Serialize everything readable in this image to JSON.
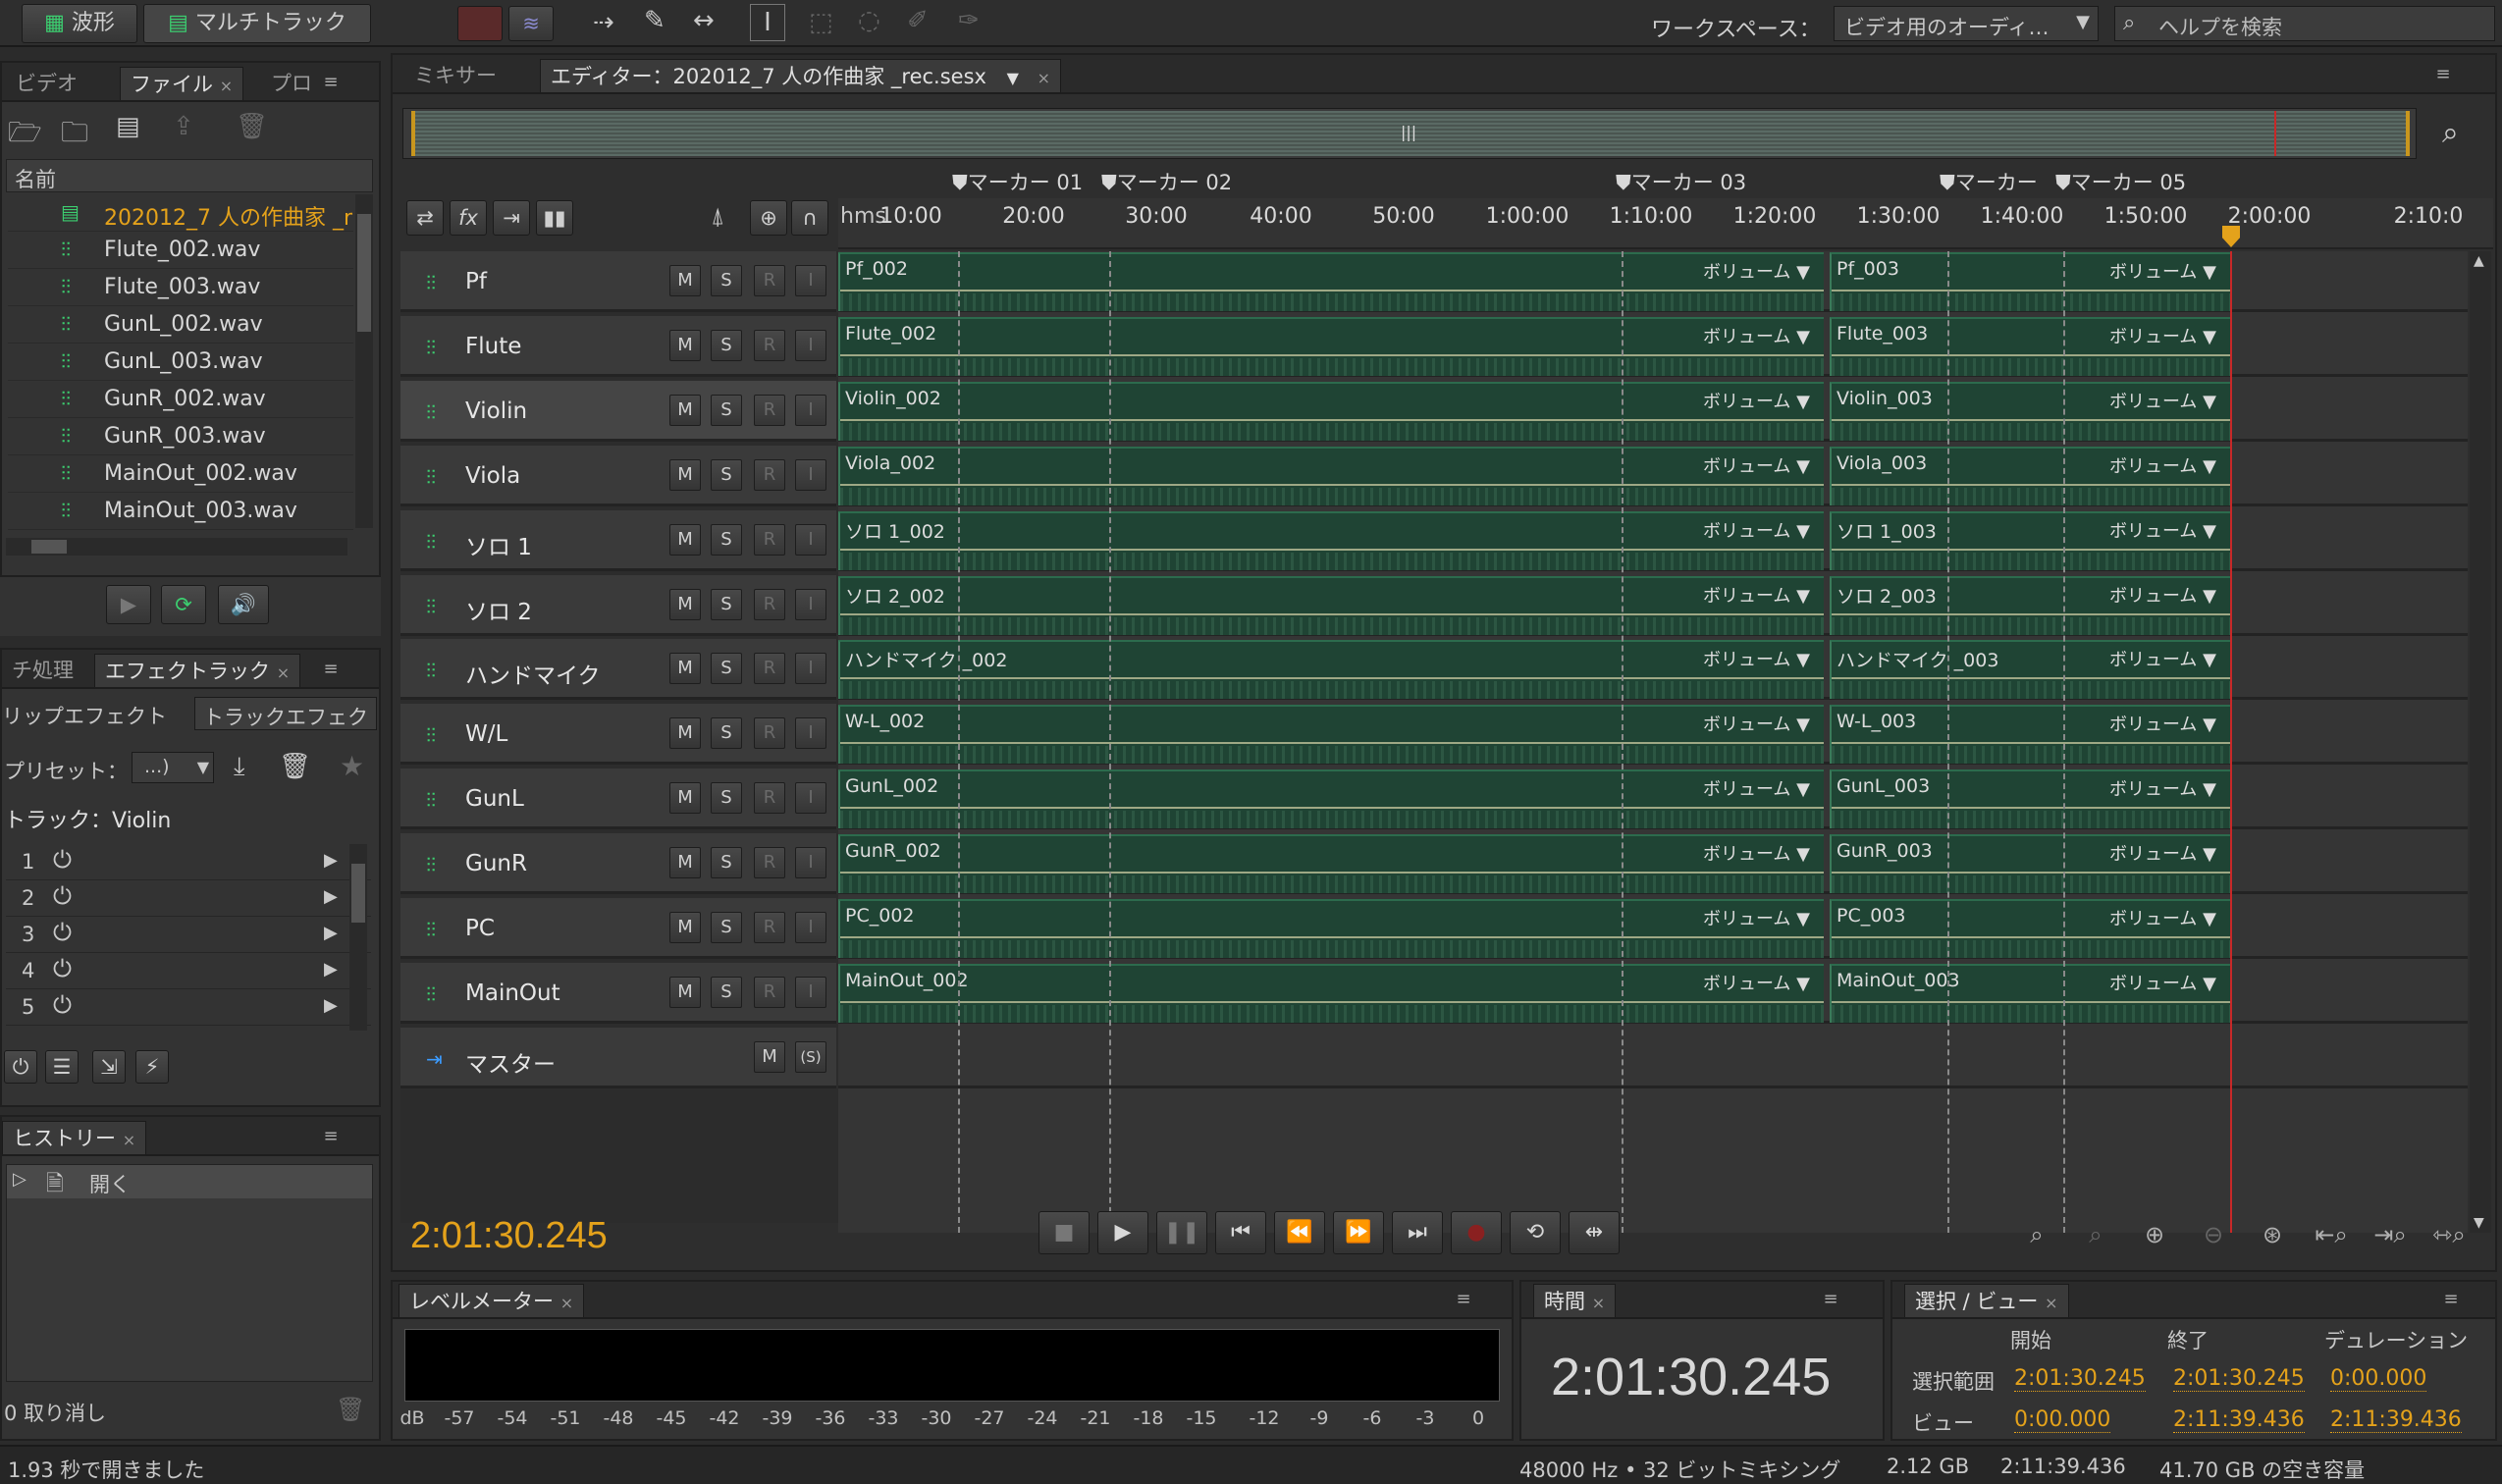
{
  "toolbar": {
    "waveform_label": "波形",
    "multitrack_label": "マルチトラック",
    "workspace_label": "ワークスペース：",
    "workspace_value": "ビデオ用のオーディ…",
    "help_placeholder": "ヘルプを検索"
  },
  "files_panel": {
    "tabs": [
      "ビデオ",
      "ファイル",
      "プロ"
    ],
    "column_name": "名前",
    "items": [
      {
        "label": "202012_7 人の作曲家 _r",
        "kind": "session"
      },
      {
        "label": "Flute_002.wav",
        "kind": "wav"
      },
      {
        "label": "Flute_003.wav",
        "kind": "wav"
      },
      {
        "label": "GunL_002.wav",
        "kind": "wav"
      },
      {
        "label": "GunL_003.wav",
        "kind": "wav"
      },
      {
        "label": "GunR_002.wav",
        "kind": "wav"
      },
      {
        "label": "GunR_003.wav",
        "kind": "wav"
      },
      {
        "label": "MainOut_002.wav",
        "kind": "wav"
      },
      {
        "label": "MainOut_003.wav",
        "kind": "wav"
      }
    ]
  },
  "effects_panel": {
    "tabs": [
      "チ処理",
      "エフェクトラック"
    ],
    "subtabs": [
      "リップエフェクト",
      "トラックエフェク"
    ],
    "preset_label": "プリセット：",
    "preset_value": "...)",
    "track_label": "トラック：Violin",
    "slots": [
      "1",
      "2",
      "3",
      "4",
      "5"
    ]
  },
  "history_panel": {
    "title": "ヒストリー",
    "entry": "開く",
    "undo_count": "0 取り消し"
  },
  "editor": {
    "mixer_tab": "ミキサー",
    "editor_tab": "エディター：202012_7 人の作曲家 _rec.sesx",
    "time_unit": "hms",
    "ruler": [
      "10:00",
      "20:00",
      "30:00",
      "40:00",
      "50:00",
      "1:00:00",
      "1:10:00",
      "1:20:00",
      "1:30:00",
      "1:40:00",
      "1:50:00",
      "2:00:00",
      "2:10:0"
    ],
    "markers": [
      "マーカー 01",
      "マーカー 02",
      "マーカー 03",
      "マーカー",
      "マーカー 05"
    ],
    "volume_label": "ボリューム",
    "tracks": [
      {
        "name": "Pf",
        "clip_a": "Pf_002",
        "clip_b": "Pf_003"
      },
      {
        "name": "Flute",
        "clip_a": "Flute_002",
        "clip_b": "Flute_003"
      },
      {
        "name": "Violin",
        "clip_a": "Violin_002",
        "clip_b": "Violin_003"
      },
      {
        "name": "Viola",
        "clip_a": "Viola_002",
        "clip_b": "Viola_003"
      },
      {
        "name": "ソロ 1",
        "clip_a": "ソロ 1_002",
        "clip_b": "ソロ 1_003"
      },
      {
        "name": "ソロ 2",
        "clip_a": "ソロ 2_002",
        "clip_b": "ソロ 2_003"
      },
      {
        "name": "ハンドマイク",
        "clip_a": "ハンドマイク _002",
        "clip_b": "ハンドマイク _003"
      },
      {
        "name": "W/L",
        "clip_a": "W-L_002",
        "clip_b": "W-L_003"
      },
      {
        "name": "GunL",
        "clip_a": "GunL_002",
        "clip_b": "GunL_003"
      },
      {
        "name": "GunR",
        "clip_a": "GunR_002",
        "clip_b": "GunR_003"
      },
      {
        "name": "PC",
        "clip_a": "PC_002",
        "clip_b": "PC_003"
      },
      {
        "name": "MainOut",
        "clip_a": "MainOut_002",
        "clip_b": "MainOut_003"
      }
    ],
    "master_label": "マスター",
    "btn_m": "M",
    "btn_s": "S",
    "btn_r": "R",
    "btn_i": "I",
    "btn_ms": "(S)",
    "current_time": "2:01:30.245"
  },
  "level_meter": {
    "title": "レベルメーター",
    "scale": [
      "dB",
      "-57",
      "-54",
      "-51",
      "-48",
      "-45",
      "-42",
      "-39",
      "-36",
      "-33",
      "-30",
      "-27",
      "-24",
      "-21",
      "-18",
      "-15",
      "-12",
      "-9",
      "-6",
      "-3",
      "0"
    ]
  },
  "time_panel": {
    "title": "時間",
    "value": "2:01:30.245"
  },
  "selection_panel": {
    "title": "選択 / ビュー",
    "col_start": "開始",
    "col_end": "終了",
    "col_duration": "デュレーション",
    "row_selection": "選択範囲",
    "row_view": "ビュー",
    "sel_start": "2:01:30.245",
    "sel_end": "2:01:30.245",
    "sel_duration": "0:00.000",
    "view_start": "0:00.000",
    "view_end": "2:11:39.436",
    "view_duration": "2:11:39.436"
  },
  "status_bar": {
    "open_time": "1.93 秒で開きました",
    "format": "48000 Hz • 32 ビットミキシング",
    "size": "2.12 GB",
    "duration": "2:11:39.436",
    "free_space": "41.70 GB の空き容量"
  },
  "colors": {
    "accent": "#e4a21b",
    "clip": "#1f4434",
    "wave": "#3ccf70",
    "playhead": "#c82828"
  }
}
